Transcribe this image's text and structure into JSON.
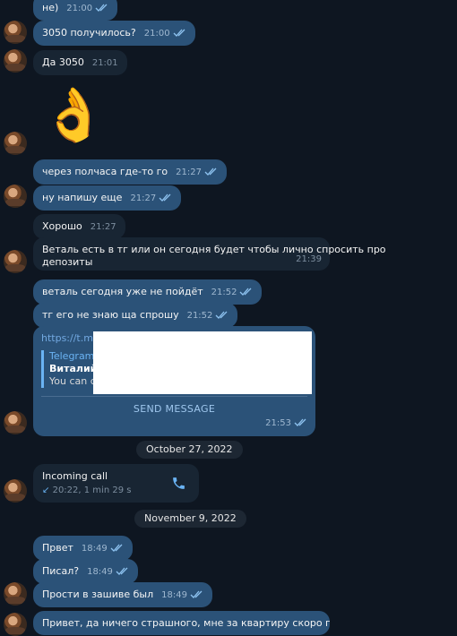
{
  "messages": [
    {
      "id": "m0",
      "side": "own",
      "text": "не)",
      "time": "21:00",
      "checks": "double"
    },
    {
      "id": "m1",
      "side": "own",
      "text": "3050 получилось?",
      "time": "21:00",
      "checks": "double"
    },
    {
      "id": "m2",
      "side": "peer",
      "text": "Да 3050",
      "time": "21:01"
    },
    {
      "id": "m3",
      "side": "own",
      "emoji": "👌"
    },
    {
      "id": "m4",
      "side": "own",
      "text": "через полчаса где-то го",
      "time": "21:27",
      "checks": "double"
    },
    {
      "id": "m5",
      "side": "own",
      "text": "ну напишу еще",
      "time": "21:27",
      "checks": "double"
    },
    {
      "id": "m6",
      "side": "peer",
      "text": "Хорошо",
      "time": "21:27"
    },
    {
      "id": "m7",
      "side": "peer",
      "text_line1": "Веталь есть в тг или он сегодня будет чтобы лично спросить про",
      "text_line2": "депозиты",
      "time": "21:39"
    },
    {
      "id": "m8",
      "side": "own",
      "text": "веталь сегодня уже не пойдёт",
      "time": "21:52",
      "checks": "double"
    },
    {
      "id": "m9",
      "side": "own",
      "text": "тг его не знаю ща спрошу",
      "time": "21:52",
      "checks": "double"
    },
    {
      "id": "m10",
      "side": "own",
      "link": "https://t.me",
      "preview_title": "Telegram",
      "preview_name": "Виталий",
      "preview_desc": "You can co",
      "button": "SEND MESSAGE",
      "time": "21:53",
      "checks": "double"
    },
    {
      "id": "m11",
      "side": "own",
      "call_title": "Incoming call",
      "call_detail": "20:22, 1 min 29 s"
    },
    {
      "id": "m12",
      "side": "own",
      "text": "Првет",
      "time": "18:49",
      "checks": "double"
    },
    {
      "id": "m13",
      "side": "own",
      "text": "Писал?",
      "time": "18:49",
      "checks": "double"
    },
    {
      "id": "m14",
      "side": "own",
      "text": "Прости в зашиве был",
      "time": "18:49",
      "checks": "double"
    },
    {
      "id": "m15",
      "side": "own",
      "text": "Привет, да ничего страшного, мне за квартиру скоро платить, не"
    }
  ],
  "date_separators": [
    {
      "label": "October 27, 2022"
    },
    {
      "label": "November 9, 2022"
    }
  ],
  "colors": {
    "background": "#0e1621",
    "own_bubble": "#2b5278",
    "peer_bubble": "#182533",
    "accent": "#6ab3f3"
  },
  "icons": {
    "read_receipt": "double-check-icon",
    "call": "phone-icon",
    "incoming": "arrow-down-left-icon"
  }
}
